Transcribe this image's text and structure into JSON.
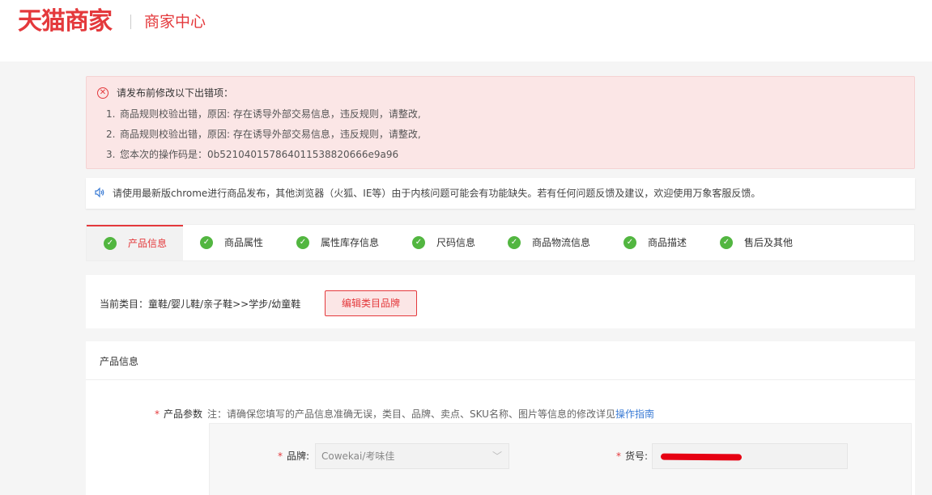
{
  "header": {
    "logo": "天猫商家",
    "subtitle": "商家中心"
  },
  "error": {
    "icon": "close-circle-icon",
    "title": "请发布前修改以下出错项：",
    "items": [
      {
        "num": "1.",
        "text": "商品规则校验出错，原因: 存在诱导外部交易信息，违反规则，请整改,"
      },
      {
        "num": "2.",
        "text": "商品规则校验出错，原因: 存在诱导外部交易信息，违反规则，请整改,"
      },
      {
        "num": "3.",
        "text": "您本次的操作码是：0b521040157864011538820666e9a96"
      }
    ],
    "colors": {
      "accent": "#e4393c",
      "background": "#fbe6e6"
    }
  },
  "notice": {
    "icon": "speaker-icon",
    "text": "请使用最新版chrome进行商品发布，其他浏览器（火狐、IE等）由于内核问题可能会有功能缺失。若有任何问题反馈及建议，欢迎使用万象客服反馈。"
  },
  "steps": [
    {
      "label": "产品信息",
      "active": true
    },
    {
      "label": "商品属性",
      "active": false
    },
    {
      "label": "属性库存信息",
      "active": false
    },
    {
      "label": "尺码信息",
      "active": false
    },
    {
      "label": "商品物流信息",
      "active": false
    },
    {
      "label": "商品描述",
      "active": false
    },
    {
      "label": "售后及其他",
      "active": false
    }
  ],
  "category": {
    "text": "当前类目：童鞋/婴儿鞋/亲子鞋>>学步/幼童鞋",
    "edit_button": "编辑类目品牌"
  },
  "product": {
    "title": "产品信息",
    "param_required": "*",
    "param_label": "产品参数",
    "param_note": "注：请确保您填写的产品信息准确无误，类目、品牌、卖点、SKU名称、图片等信息的修改详见",
    "param_link": "操作指南",
    "brand_required": "*",
    "brand_label": "品牌:",
    "brand_value": "Cowekai/考味佳",
    "sku_required": "*",
    "sku_label": "货号:"
  },
  "colors": {
    "brand": "#e4393c",
    "success": "#52b640",
    "link": "#3a7bd5"
  }
}
